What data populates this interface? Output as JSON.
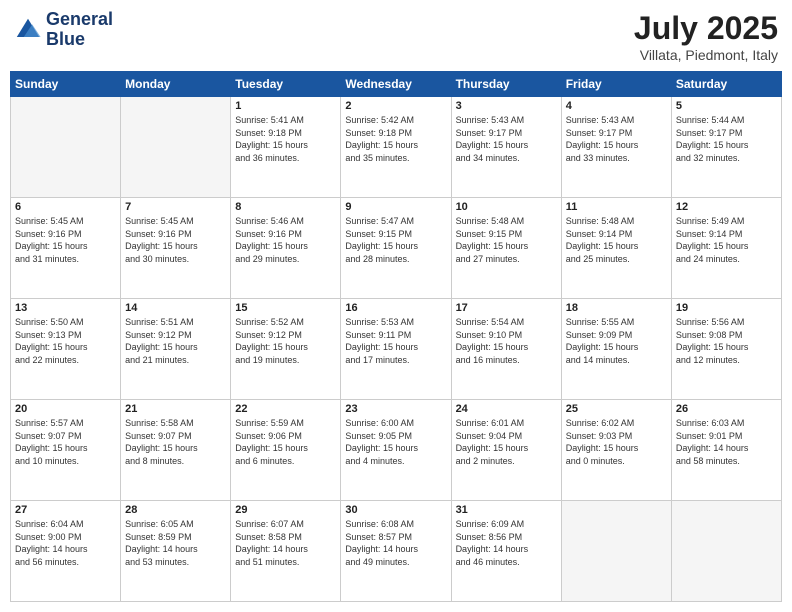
{
  "header": {
    "logo_line1": "General",
    "logo_line2": "Blue",
    "month": "July 2025",
    "location": "Villata, Piedmont, Italy"
  },
  "weekdays": [
    "Sunday",
    "Monday",
    "Tuesday",
    "Wednesday",
    "Thursday",
    "Friday",
    "Saturday"
  ],
  "weeks": [
    [
      {
        "day": "",
        "text": ""
      },
      {
        "day": "",
        "text": ""
      },
      {
        "day": "1",
        "text": "Sunrise: 5:41 AM\nSunset: 9:18 PM\nDaylight: 15 hours\nand 36 minutes."
      },
      {
        "day": "2",
        "text": "Sunrise: 5:42 AM\nSunset: 9:18 PM\nDaylight: 15 hours\nand 35 minutes."
      },
      {
        "day": "3",
        "text": "Sunrise: 5:43 AM\nSunset: 9:17 PM\nDaylight: 15 hours\nand 34 minutes."
      },
      {
        "day": "4",
        "text": "Sunrise: 5:43 AM\nSunset: 9:17 PM\nDaylight: 15 hours\nand 33 minutes."
      },
      {
        "day": "5",
        "text": "Sunrise: 5:44 AM\nSunset: 9:17 PM\nDaylight: 15 hours\nand 32 minutes."
      }
    ],
    [
      {
        "day": "6",
        "text": "Sunrise: 5:45 AM\nSunset: 9:16 PM\nDaylight: 15 hours\nand 31 minutes."
      },
      {
        "day": "7",
        "text": "Sunrise: 5:45 AM\nSunset: 9:16 PM\nDaylight: 15 hours\nand 30 minutes."
      },
      {
        "day": "8",
        "text": "Sunrise: 5:46 AM\nSunset: 9:16 PM\nDaylight: 15 hours\nand 29 minutes."
      },
      {
        "day": "9",
        "text": "Sunrise: 5:47 AM\nSunset: 9:15 PM\nDaylight: 15 hours\nand 28 minutes."
      },
      {
        "day": "10",
        "text": "Sunrise: 5:48 AM\nSunset: 9:15 PM\nDaylight: 15 hours\nand 27 minutes."
      },
      {
        "day": "11",
        "text": "Sunrise: 5:48 AM\nSunset: 9:14 PM\nDaylight: 15 hours\nand 25 minutes."
      },
      {
        "day": "12",
        "text": "Sunrise: 5:49 AM\nSunset: 9:14 PM\nDaylight: 15 hours\nand 24 minutes."
      }
    ],
    [
      {
        "day": "13",
        "text": "Sunrise: 5:50 AM\nSunset: 9:13 PM\nDaylight: 15 hours\nand 22 minutes."
      },
      {
        "day": "14",
        "text": "Sunrise: 5:51 AM\nSunset: 9:12 PM\nDaylight: 15 hours\nand 21 minutes."
      },
      {
        "day": "15",
        "text": "Sunrise: 5:52 AM\nSunset: 9:12 PM\nDaylight: 15 hours\nand 19 minutes."
      },
      {
        "day": "16",
        "text": "Sunrise: 5:53 AM\nSunset: 9:11 PM\nDaylight: 15 hours\nand 17 minutes."
      },
      {
        "day": "17",
        "text": "Sunrise: 5:54 AM\nSunset: 9:10 PM\nDaylight: 15 hours\nand 16 minutes."
      },
      {
        "day": "18",
        "text": "Sunrise: 5:55 AM\nSunset: 9:09 PM\nDaylight: 15 hours\nand 14 minutes."
      },
      {
        "day": "19",
        "text": "Sunrise: 5:56 AM\nSunset: 9:08 PM\nDaylight: 15 hours\nand 12 minutes."
      }
    ],
    [
      {
        "day": "20",
        "text": "Sunrise: 5:57 AM\nSunset: 9:07 PM\nDaylight: 15 hours\nand 10 minutes."
      },
      {
        "day": "21",
        "text": "Sunrise: 5:58 AM\nSunset: 9:07 PM\nDaylight: 15 hours\nand 8 minutes."
      },
      {
        "day": "22",
        "text": "Sunrise: 5:59 AM\nSunset: 9:06 PM\nDaylight: 15 hours\nand 6 minutes."
      },
      {
        "day": "23",
        "text": "Sunrise: 6:00 AM\nSunset: 9:05 PM\nDaylight: 15 hours\nand 4 minutes."
      },
      {
        "day": "24",
        "text": "Sunrise: 6:01 AM\nSunset: 9:04 PM\nDaylight: 15 hours\nand 2 minutes."
      },
      {
        "day": "25",
        "text": "Sunrise: 6:02 AM\nSunset: 9:03 PM\nDaylight: 15 hours\nand 0 minutes."
      },
      {
        "day": "26",
        "text": "Sunrise: 6:03 AM\nSunset: 9:01 PM\nDaylight: 14 hours\nand 58 minutes."
      }
    ],
    [
      {
        "day": "27",
        "text": "Sunrise: 6:04 AM\nSunset: 9:00 PM\nDaylight: 14 hours\nand 56 minutes."
      },
      {
        "day": "28",
        "text": "Sunrise: 6:05 AM\nSunset: 8:59 PM\nDaylight: 14 hours\nand 53 minutes."
      },
      {
        "day": "29",
        "text": "Sunrise: 6:07 AM\nSunset: 8:58 PM\nDaylight: 14 hours\nand 51 minutes."
      },
      {
        "day": "30",
        "text": "Sunrise: 6:08 AM\nSunset: 8:57 PM\nDaylight: 14 hours\nand 49 minutes."
      },
      {
        "day": "31",
        "text": "Sunrise: 6:09 AM\nSunset: 8:56 PM\nDaylight: 14 hours\nand 46 minutes."
      },
      {
        "day": "",
        "text": ""
      },
      {
        "day": "",
        "text": ""
      }
    ]
  ]
}
